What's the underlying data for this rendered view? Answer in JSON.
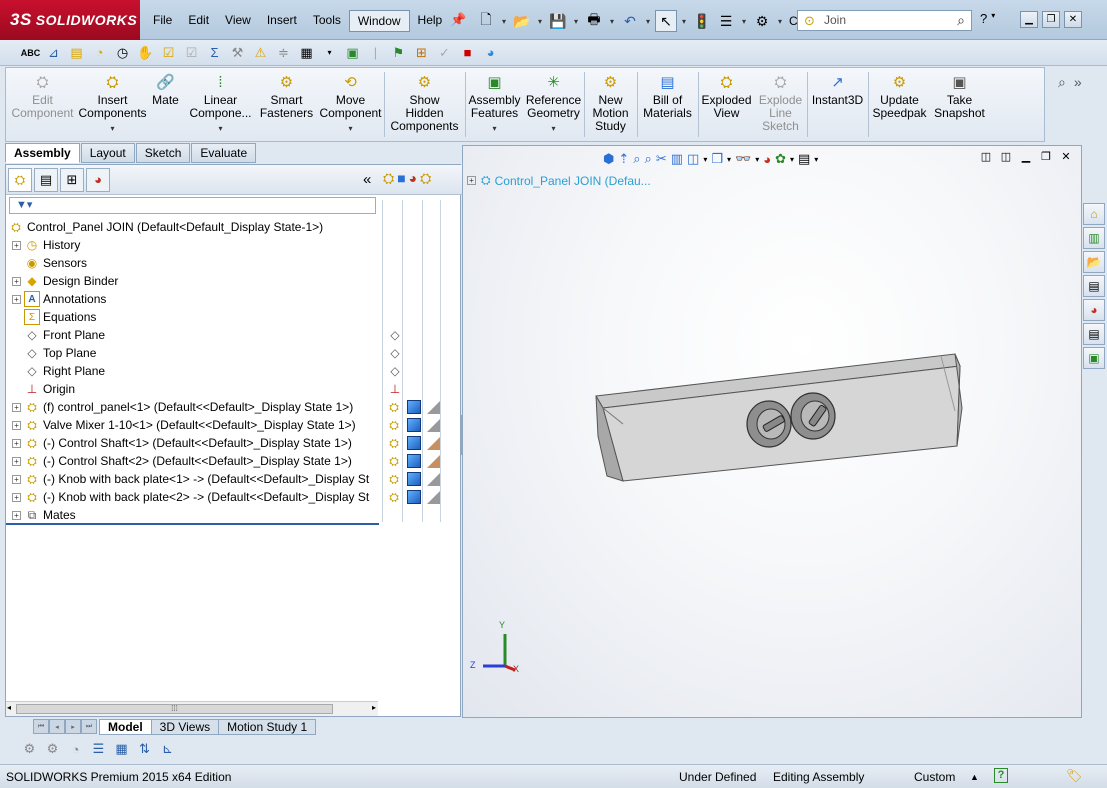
{
  "app": {
    "logo_text": "SOLIDWORKS",
    "logo_prefix": "3S"
  },
  "menu": [
    "File",
    "Edit",
    "View",
    "Insert",
    "Tools",
    "Window",
    "Help"
  ],
  "menu_active": "Window",
  "quickbar": {
    "truncated_label": "C..."
  },
  "search": {
    "value": "Join"
  },
  "help_glyph": "?",
  "command_manager": [
    {
      "name": "edit-component",
      "label1": "Edit",
      "label2": "Component",
      "disabled": true,
      "icon": "edit-component-icon",
      "dropdown": false
    },
    {
      "name": "insert-components",
      "label1": "Insert",
      "label2": "Components",
      "disabled": false,
      "icon": "insert-components-icon",
      "dropdown": true
    },
    {
      "name": "mate",
      "label1": "Mate",
      "label2": "",
      "disabled": false,
      "icon": "mate-icon",
      "dropdown": false
    },
    {
      "name": "linear-component-pattern",
      "label1": "Linear",
      "label2": "Compone...",
      "disabled": false,
      "icon": "linear-pattern-icon",
      "dropdown": true
    },
    {
      "name": "smart-fasteners",
      "label1": "Smart",
      "label2": "Fasteners",
      "disabled": false,
      "icon": "smart-fasteners-icon",
      "dropdown": false
    },
    {
      "name": "move-component",
      "label1": "Move",
      "label2": "Component",
      "disabled": false,
      "icon": "move-component-icon",
      "dropdown": true
    },
    {
      "name": "show-hidden-components",
      "label1": "Show",
      "label2": "Hidden",
      "label3": "Components",
      "disabled": false,
      "icon": "show-hidden-icon",
      "dropdown": false
    },
    {
      "name": "assembly-features",
      "label1": "Assembly",
      "label2": "Features",
      "disabled": false,
      "icon": "assembly-features-icon",
      "dropdown": true
    },
    {
      "name": "reference-geometry",
      "label1": "Reference",
      "label2": "Geometry",
      "disabled": false,
      "icon": "reference-geometry-icon",
      "dropdown": true
    },
    {
      "name": "new-motion-study",
      "label1": "New",
      "label2": "Motion",
      "label3": "Study",
      "disabled": false,
      "icon": "motion-study-icon",
      "dropdown": false
    },
    {
      "name": "bill-of-materials",
      "label1": "Bill of",
      "label2": "Materials",
      "disabled": false,
      "icon": "bom-icon",
      "dropdown": false
    },
    {
      "name": "exploded-view",
      "label1": "Exploded",
      "label2": "View",
      "disabled": false,
      "icon": "exploded-view-icon",
      "dropdown": false
    },
    {
      "name": "explode-line-sketch",
      "label1": "Explode",
      "label2": "Line",
      "label3": "Sketch",
      "disabled": true,
      "icon": "explode-line-icon",
      "dropdown": false
    },
    {
      "name": "instant3d",
      "label1": "Instant3D",
      "label2": "",
      "disabled": false,
      "icon": "instant3d-icon",
      "dropdown": false
    },
    {
      "name": "update-speedpak",
      "label1": "Update",
      "label2": "Speedpak",
      "disabled": false,
      "icon": "speedpak-icon",
      "dropdown": false
    },
    {
      "name": "take-snapshot",
      "label1": "Take",
      "label2": "Snapshot",
      "disabled": false,
      "icon": "snapshot-icon",
      "dropdown": false
    }
  ],
  "cm_tabs": [
    "Assembly",
    "Layout",
    "Sketch",
    "Evaluate"
  ],
  "cm_tab_active": "Assembly",
  "tree": {
    "root": "Control_Panel JOIN  (Default<Default_Display State-1>)",
    "nodes": [
      {
        "label": "History",
        "icon": "history-icon",
        "expandable": true
      },
      {
        "label": "Sensors",
        "icon": "sensors-icon",
        "expandable": false
      },
      {
        "label": "Design Binder",
        "icon": "design-binder-icon",
        "expandable": true
      },
      {
        "label": "Annotations",
        "icon": "annotations-icon",
        "expandable": true
      },
      {
        "label": "Equations",
        "icon": "equations-icon",
        "expandable": false
      },
      {
        "label": "Front Plane",
        "icon": "plane-icon",
        "expandable": false
      },
      {
        "label": "Top Plane",
        "icon": "plane-icon",
        "expandable": false
      },
      {
        "label": "Right Plane",
        "icon": "plane-icon",
        "expandable": false
      },
      {
        "label": "Origin",
        "icon": "origin-icon",
        "expandable": false
      },
      {
        "label": "(f) control_panel<1> (Default<<Default>_Display State 1>)",
        "icon": "part-icon",
        "expandable": true
      },
      {
        "label": "Valve Mixer 1-10<1> (Default<<Default>_Display State 1>)",
        "icon": "part-icon",
        "expandable": true
      },
      {
        "label": "(-) Control Shaft<1> (Default<<Default>_Display State 1>)",
        "icon": "part-icon",
        "expandable": true
      },
      {
        "label": "(-) Control Shaft<2> (Default<<Default>_Display State 1>)",
        "icon": "part-icon",
        "expandable": true
      },
      {
        "label": "(-) Knob with back plate<1> -> (Default<<Default>_Display St",
        "icon": "part-icon",
        "expandable": true
      },
      {
        "label": "(-) Knob with back plate<2> -> (Default<<Default>_Display St",
        "icon": "part-icon",
        "expandable": true
      },
      {
        "label": "Mates",
        "icon": "mates-icon",
        "expandable": true
      }
    ]
  },
  "viewport_tree": "Control_Panel JOIN  (Defau...",
  "triad": {
    "x": "X",
    "y": "Y",
    "z": "Z"
  },
  "bottom_tabs": [
    "Model",
    "3D Views",
    "Motion Study 1"
  ],
  "bottom_tab_active": "Model",
  "status": {
    "edition": "SOLIDWORKS Premium 2015 x64 Edition",
    "state": "Under Defined",
    "mode": "Editing Assembly",
    "units": "Custom",
    "units_arrow": "▲",
    "help": "?"
  }
}
